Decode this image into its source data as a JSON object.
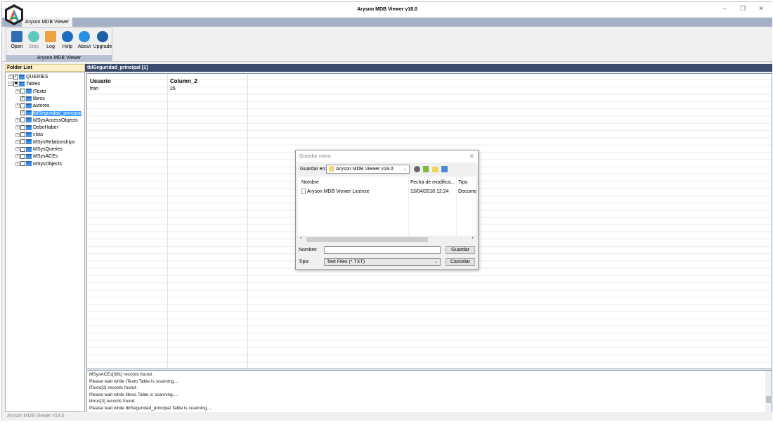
{
  "window": {
    "title": "Aryson MDB Viewer v18.0",
    "minimize": "–",
    "maximize": "❐",
    "close": "✕"
  },
  "ribbon": {
    "tab": "Aryson MDB Viewer",
    "group_label": "Aryson MDB Viewer",
    "buttons": [
      {
        "label": "Open",
        "color": "#2e6db4"
      },
      {
        "label": "Stop",
        "color": "#5fc6c0"
      },
      {
        "label": "Log",
        "color": "#f0a040"
      },
      {
        "label": "Help",
        "color": "#1e6cc0"
      },
      {
        "label": "About",
        "color": "#2a8fe0"
      },
      {
        "label": "Upgrade",
        "color": "#1a5fa8"
      }
    ]
  },
  "folder_list": {
    "header": "Folder List",
    "root": [
      {
        "label": "QUERIES",
        "checked": true
      },
      {
        "label": "Tables",
        "checked": "partial"
      }
    ],
    "tables": [
      {
        "label": "tTexto",
        "checked": false,
        "expand": true
      },
      {
        "label": "libros",
        "checked": true,
        "expand": false
      },
      {
        "label": "autores",
        "checked": false,
        "expand": true
      },
      {
        "label": "tblSeguridad_principal",
        "checked": true,
        "expand": false,
        "selected": true
      },
      {
        "label": "MSysAccessObjects",
        "checked": false,
        "expand": true
      },
      {
        "label": "DebeHaber",
        "checked": false,
        "expand": true
      },
      {
        "label": "citas",
        "checked": false,
        "expand": true
      },
      {
        "label": "MSysRelationships",
        "checked": false,
        "expand": true
      },
      {
        "label": "MSysQueries",
        "checked": false,
        "expand": true
      },
      {
        "label": "MSysACEs",
        "checked": false,
        "expand": true
      },
      {
        "label": "MSysObjects",
        "checked": false,
        "expand": true
      }
    ]
  },
  "grid": {
    "title": "tblSeguridad_principal [1]",
    "columns": [
      "Usuario",
      "Column_2"
    ],
    "rows": [
      [
        "fran",
        "26"
      ]
    ]
  },
  "log": [
    "MSysACEs[381] records found.",
    "Please wait while tTexto Table is scanning....",
    "tTexto[2] records found.",
    "Please wait while libros Table is scanning....",
    "libros[3] records found.",
    "Please wait while tblSeguridad_principal Table is scanning...."
  ],
  "status": "Aryson MDB Viewer v18.0",
  "dialog": {
    "title": "Guardar como",
    "save_in_label": "Guardar en:",
    "save_in_value": "Aryson MDB Viewer v18.0",
    "columns": [
      "Nombre",
      "Fecha de modifica...",
      "Tipo"
    ],
    "files": [
      {
        "name": "Aryson MDB Viewer License",
        "date": "13/04/2018 12:24",
        "type": "Docume"
      }
    ],
    "name_label": "Nombre:",
    "name_value": "",
    "type_label": "Tipo:",
    "type_value": "Text Files (*.TXT)",
    "save_button": "Guardar",
    "cancel_button": "Cancelar"
  }
}
